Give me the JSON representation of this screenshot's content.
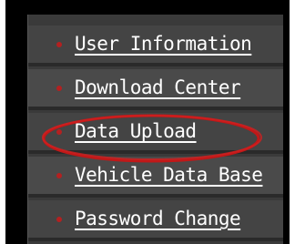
{
  "menu": {
    "items": [
      {
        "label": "User Information"
      },
      {
        "label": "Download Center"
      },
      {
        "label": "Data Upload",
        "highlighted": true
      },
      {
        "label": "Vehicle Data Base"
      },
      {
        "label": "Password Change"
      }
    ],
    "bullet_icon": "red-dot-bullet-icon",
    "highlight_color": "#c01818",
    "bullet_color": "#b42020",
    "text_color": "#ffffff"
  }
}
